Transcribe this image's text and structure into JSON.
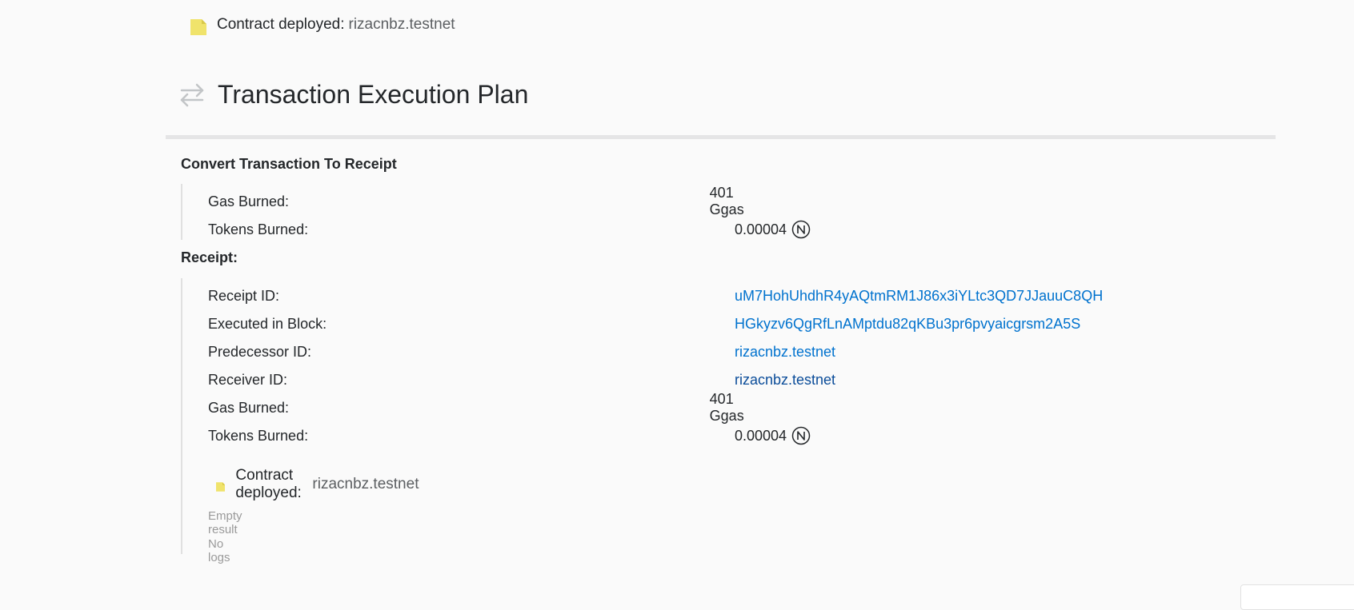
{
  "top_action": {
    "label": "Contract deployed:",
    "account": "rizacnbz.testnet"
  },
  "section": {
    "title": "Transaction Execution Plan"
  },
  "convert": {
    "title": "Convert Transaction To Receipt",
    "rows": [
      {
        "key": "Gas Burned:",
        "value": "401 Ggas"
      },
      {
        "key": "Tokens Burned:",
        "value": "0.00004"
      }
    ]
  },
  "receipt": {
    "title": "Receipt:",
    "rows": [
      {
        "key": "Receipt ID:",
        "value": "uM7HohUhdhR4yAQtmRM1J86x3iYLtc3QD7JJauuC8QH"
      },
      {
        "key": "Executed in Block:",
        "value": "HGkyzv6QgRfLnAMptdu82qKBu3pr6pvyaicgrsm2A5S"
      },
      {
        "key": "Predecessor ID:",
        "value": "rizacnbz.testnet"
      },
      {
        "key": "Receiver ID:",
        "value": "rizacnbz.testnet"
      },
      {
        "key": "Gas Burned:",
        "value": "401 Ggas"
      },
      {
        "key": "Tokens Burned:",
        "value": "0.00004"
      }
    ],
    "action": {
      "label": "Contract deployed:",
      "account": "rizacnbz.testnet"
    },
    "result": "Empty result",
    "logs": "No logs"
  },
  "icons": {
    "action": "contract-document-icon",
    "section": "swap-arrows-icon",
    "token": "near-token-icon"
  },
  "colors": {
    "link": "#0072ce",
    "document_icon": "#f0e36b",
    "muted_text": "#9a9a9a"
  }
}
